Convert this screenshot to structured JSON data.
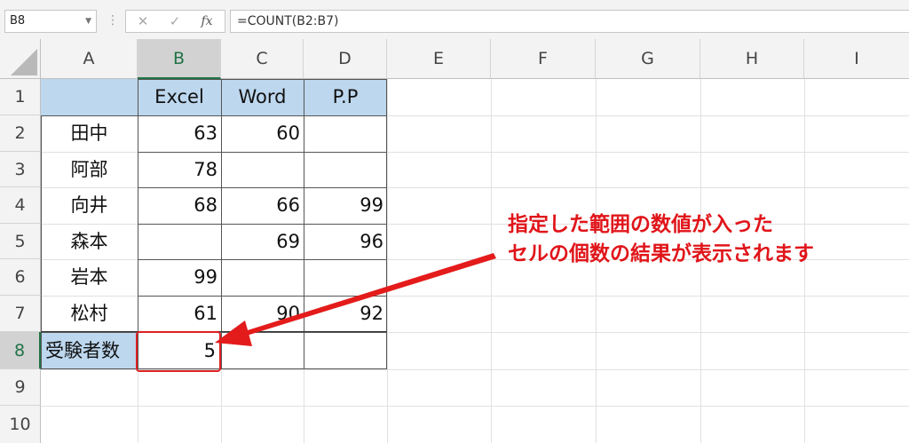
{
  "name_box": {
    "value": "B8"
  },
  "formula_bar": {
    "cancel_symbol": "✕",
    "enter_symbol": "✓",
    "function_symbol": "fx",
    "formula": "=COUNT(B2:B7)"
  },
  "columns": [
    "A",
    "B",
    "C",
    "D",
    "E",
    "F",
    "G",
    "H",
    "I"
  ],
  "rows": [
    "1",
    "2",
    "3",
    "4",
    "5",
    "6",
    "7",
    "8",
    "9",
    "10"
  ],
  "table": {
    "header": {
      "a": "",
      "b": "Excel",
      "c": "Word",
      "d": "P.P"
    },
    "rows": [
      {
        "a": "田中",
        "b": "63",
        "c": "60",
        "d": ""
      },
      {
        "a": "阿部",
        "b": "78",
        "c": "",
        "d": ""
      },
      {
        "a": "向井",
        "b": "68",
        "c": "66",
        "d": "99"
      },
      {
        "a": "森本",
        "b": "",
        "c": "69",
        "d": "96"
      },
      {
        "a": "岩本",
        "b": "99",
        "c": "",
        "d": ""
      },
      {
        "a": "松村",
        "b": "61",
        "c": "90",
        "d": "92"
      }
    ],
    "result": {
      "a": "受験者数",
      "b": "5",
      "c": "",
      "d": ""
    }
  },
  "annotation": {
    "line1": "指定した範囲の数値が入った",
    "line2": "セルの個数の結果が表示されます",
    "color": "#e0151a"
  },
  "colors": {
    "header_fill": "#bdd7ee",
    "selection_green": "#217346"
  }
}
